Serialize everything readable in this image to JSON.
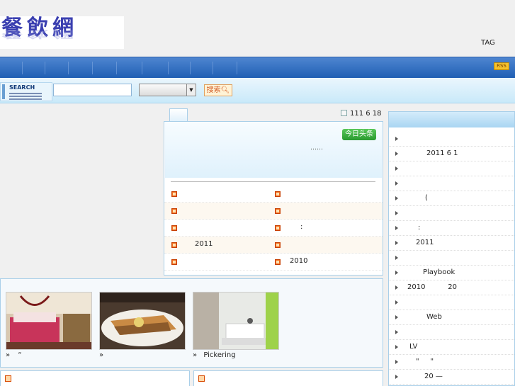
{
  "logo": {
    "text": "餐飲網"
  },
  "header": {
    "tag_label": "TAG",
    "rss_label": "RSS"
  },
  "search": {
    "label": "SEARCH",
    "input_value": "",
    "select_value": "",
    "button_label": "搜索"
  },
  "news": {
    "date": "111 6 18",
    "headline_badge": "今日头条",
    "summary_dots": "……",
    "rows_left": [
      {
        "text": ""
      },
      {
        "text": ""
      },
      {
        "text": ""
      },
      {
        "text": "2011"
      },
      {
        "text": ""
      }
    ],
    "rows_right": [
      {
        "text": ""
      },
      {
        "text": ""
      },
      {
        "text": ":"
      },
      {
        "text": ""
      },
      {
        "text": "2010"
      }
    ]
  },
  "gallery": {
    "items": [
      {
        "caption_prefix": "»",
        "caption": "“"
      },
      {
        "caption_prefix": "»",
        "caption": ""
      },
      {
        "caption_prefix": "»",
        "caption": "Pickering"
      }
    ]
  },
  "sidebar": {
    "items": [
      {
        "text": ""
      },
      {
        "text": "2011 6 1"
      },
      {
        "text": ""
      },
      {
        "text": ""
      },
      {
        "text": "("
      },
      {
        "text": ""
      },
      {
        "text": ":"
      },
      {
        "text": "2011"
      },
      {
        "text": ""
      },
      {
        "text": "Playbook"
      },
      {
        "text": "2010          20"
      },
      {
        "text": ""
      },
      {
        "text": "Web"
      },
      {
        "text": ""
      },
      {
        "text": "LV"
      },
      {
        "text": "\"     \""
      },
      {
        "text": "20 —"
      }
    ]
  },
  "colors": {
    "nav": "#1f5fb4",
    "accent": "#f06b1c",
    "badge": "#2a9a30"
  }
}
